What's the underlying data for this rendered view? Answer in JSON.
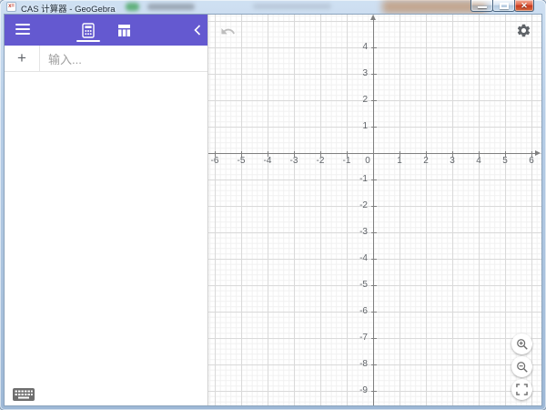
{
  "window": {
    "title": "CAS 计算器 - GeoGebra",
    "icon_label": "x=",
    "controls": {
      "minimize": "minimize",
      "maximize": "maximize",
      "close": "✕"
    }
  },
  "colors": {
    "accent": "#6459d0",
    "close-red": "#c6391f",
    "axis": "#808080",
    "grid-major": "#dadada",
    "grid-minor": "#f1f1f1",
    "placeholder": "#9e9e9e"
  },
  "header": {
    "active_tab": "calculator",
    "tabs": [
      {
        "id": "calculator",
        "icon": "calculator-icon"
      },
      {
        "id": "table",
        "icon": "table-icon"
      }
    ]
  },
  "input_row": {
    "add_label": "+",
    "placeholder": "输入..."
  },
  "graph": {
    "x_ticks": [
      -6,
      -5,
      -4,
      -3,
      -2,
      -1,
      0,
      1,
      2,
      3,
      4,
      5,
      6
    ],
    "y_ticks": [
      4,
      3,
      2,
      1,
      -1,
      -2,
      -3,
      -4,
      -5,
      -6,
      -7,
      -8,
      -9
    ],
    "xlim": [
      -6.3,
      6.4
    ],
    "ylim": [
      -9.6,
      5.2
    ],
    "grid": "major+minor",
    "tools": [
      "undo",
      "settings",
      "zoom-in",
      "zoom-out",
      "fullscreen"
    ]
  }
}
